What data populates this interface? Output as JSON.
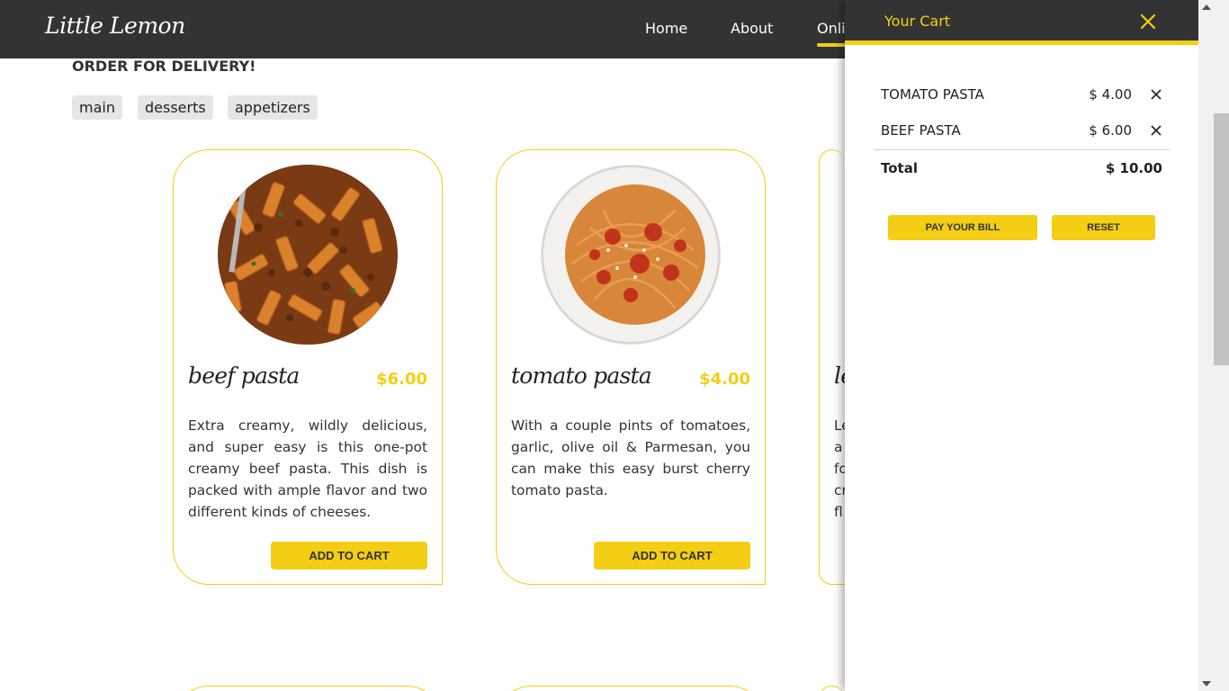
{
  "header": {
    "logo": "Little Lemon",
    "nav": [
      {
        "label": "Home"
      },
      {
        "label": "About"
      },
      {
        "label": "Onli"
      }
    ]
  },
  "main": {
    "title": "ORDER FOR DELIVERY!",
    "categories": [
      "main",
      "desserts",
      "appetizers"
    ],
    "cards": [
      {
        "name": "beef pasta",
        "price": "$6.00",
        "description": "Extra creamy, wildly delicious, and super easy is this one-pot creamy beef pasta. This dish is packed with ample flavor and two different kinds of cheeses.",
        "button": "ADD TO CART"
      },
      {
        "name": "tomato pasta",
        "price": "$4.00",
        "description": "With a couple pints of tomatoes, garlic, olive oil & Parmesan, you can make this easy burst cherry tomato pasta.",
        "button": "ADD TO CART"
      },
      {
        "name": "le",
        "desc_lines": [
          "Le",
          "a",
          "fo",
          "cr",
          "fl"
        ]
      }
    ]
  },
  "cart": {
    "title": "Your Cart",
    "items": [
      {
        "name": "TOMATO PASTA",
        "price": "$ 4.00"
      },
      {
        "name": "BEEF PASTA",
        "price": "$ 6.00"
      }
    ],
    "total_label": "Total",
    "total_value": "$ 10.00",
    "pay_button": "PAY YOUR BILL",
    "reset_button": "RESET"
  },
  "colors": {
    "dark": "#333333",
    "accent": "#f4ce14"
  }
}
